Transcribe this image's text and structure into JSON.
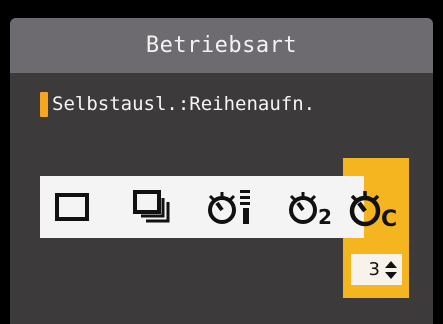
{
  "header": {
    "title": "Betriebsart"
  },
  "mode": {
    "label": "Selbstausl.:Reihenaufn."
  },
  "drive_modes": [
    {
      "icon": "single-shot-icon"
    },
    {
      "icon": "continuous-shooting-icon"
    },
    {
      "icon": "self-timer-10s-icon"
    },
    {
      "icon": "self-timer-2s-icon",
      "suffix": "2"
    },
    {
      "icon": "self-timer-continuous-icon",
      "suffix": "C",
      "selected": true
    }
  ],
  "shot_count": {
    "value": "3"
  },
  "colors": {
    "accent": "#f5b521",
    "background": "#3c3a3b",
    "title_bar": "#6e6b70",
    "strip": "#f4f4f4"
  }
}
